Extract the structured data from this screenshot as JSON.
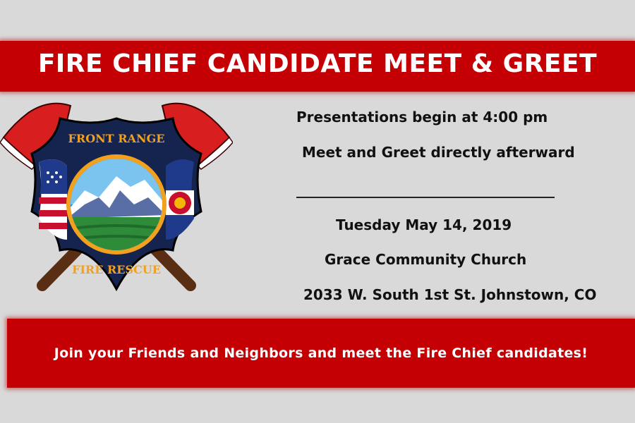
{
  "header": {
    "title": "FIRE CHIEF CANDIDATE MEET & GREET"
  },
  "event": {
    "presentations": "Presentations begin at 4:00 pm",
    "meet_greet": "Meet and Greet directly afterward",
    "date": "Tuesday May 14, 2019",
    "venue": "Grace Community Church",
    "address": "2033 W. South 1st St. Johnstown, CO"
  },
  "footer": {
    "tagline": "Join your Friends and Neighbors and meet the Fire Chief candidates!"
  },
  "logo": {
    "top_text": "FRONT RANGE",
    "bottom_text": "FIRE RESCUE"
  },
  "colors": {
    "banner_red": "#c40005",
    "background": "#d9d9d9",
    "badge_navy": "#15244f",
    "badge_gold": "#f2a11e"
  }
}
